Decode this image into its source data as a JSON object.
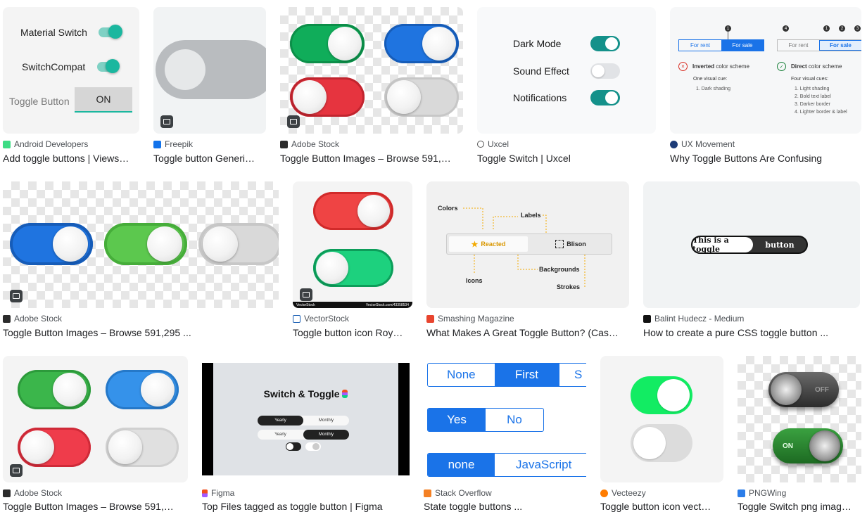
{
  "results": [
    {
      "source": "Android Developers",
      "title": "Add toggle buttons | Views…",
      "labels": {
        "material_switch": "Material Switch",
        "switchcompat": "SwitchCompat",
        "toggle_button": "Toggle Button",
        "on": "ON"
      }
    },
    {
      "source": "Freepik",
      "title": "Toggle button Generi…"
    },
    {
      "source": "Adobe Stock",
      "title": "Toggle Button Images – Browse 591,…"
    },
    {
      "source": "Uxcel",
      "title": "Toggle Switch | Uxcel",
      "labels": {
        "dark_mode": "Dark Mode",
        "sound_effect": "Sound Effect",
        "notifications": "Notifications"
      }
    },
    {
      "source": "UX Movement",
      "title": "Why Toggle Buttons Are Confusing",
      "labels": {
        "for_rent": "For rent",
        "for_sale": "For sale",
        "inverted": "Inverted",
        "inverted_rest": " color scheme",
        "direct": "Direct",
        "direct_rest": " color scheme",
        "one_cue": "One visual cue:",
        "four_cues": "Four visual cues:",
        "cue_dark": "1. Dark shading",
        "cue_1": "1. Light shading",
        "cue_2": "2. Bold text label",
        "cue_3": "3. Darker border",
        "cue_4": "4. Lighter border & label",
        "n1": "1",
        "n2": "2",
        "n3": "3",
        "n4": "4"
      }
    },
    {
      "source": "Adobe Stock",
      "title": "Toggle Button Images – Browse 591,295 ..."
    },
    {
      "source": "VectorStock",
      "title": "Toggle button icon Roy…",
      "labels": {
        "brand": "VectorStock",
        "url": "VectorStock.com/43358534"
      }
    },
    {
      "source": "Smashing Magazine",
      "title": "What Makes A Great Toggle Button? (Cas…",
      "labels": {
        "colors": "Colors",
        "labels": "Labels",
        "reacted": "Reacted",
        "blison": "Blison",
        "backgrounds": "Backgrounds",
        "icons": "Icons",
        "strokes": "Strokes"
      }
    },
    {
      "source": "Balint Hudecz - Medium",
      "title": "How to create a pure CSS toggle button ...",
      "labels": {
        "left": "This is a toggle",
        "right": "button"
      }
    },
    {
      "source": "Adobe Stock",
      "title": "Toggle Button Images – Browse 591,…"
    },
    {
      "source": "Figma",
      "title": "Top Files tagged as toggle button | Figma",
      "labels": {
        "heading": "Switch & Toggle",
        "yearly": "Yearly",
        "monthly": "Monthly"
      }
    },
    {
      "source": "Stack Overflow",
      "title": "State toggle buttons ...",
      "labels": {
        "none": "None",
        "first": "First",
        "s": "S",
        "yes": "Yes",
        "no": "No",
        "none_lc": "none",
        "javascript": "JavaScript"
      }
    },
    {
      "source": "Vecteezy",
      "title": "Toggle button icon vect…"
    },
    {
      "source": "PNGWing",
      "title": "Toggle Switch png imag…",
      "labels": {
        "off": "OFF",
        "on": "ON"
      }
    }
  ],
  "colors": {
    "teal": "#14918a",
    "green": "#0db057",
    "blue": "#1a73e8",
    "red": "#e5323f"
  }
}
